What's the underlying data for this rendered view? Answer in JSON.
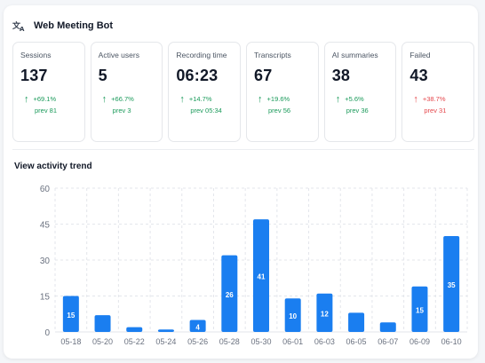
{
  "app": {
    "title": "Web Meeting Bot",
    "logo_icon": "translate-icon"
  },
  "colors": {
    "positive": "#1a9a5a",
    "negative": "#e5484d",
    "bar": "#1a7ef0",
    "grid": "#e3e6eb"
  },
  "stats": [
    {
      "label": "Sessions",
      "value": "137",
      "change": "+69.1%",
      "prev": "prev 81",
      "trend": "up"
    },
    {
      "label": "Active users",
      "value": "5",
      "change": "+66.7%",
      "prev": "prev 3",
      "trend": "up"
    },
    {
      "label": "Recording time",
      "value": "06:23",
      "change": "+14.7%",
      "prev": "prev 05:34",
      "trend": "up"
    },
    {
      "label": "Transcripts",
      "value": "67",
      "change": "+19.6%",
      "prev": "prev 56",
      "trend": "up"
    },
    {
      "label": "AI summaries",
      "value": "38",
      "change": "+5.6%",
      "prev": "prev 36",
      "trend": "up"
    },
    {
      "label": "Failed",
      "value": "43",
      "change": "+38.7%",
      "prev": "prev 31",
      "trend": "down"
    }
  ],
  "trend": {
    "title": "View activity trend"
  },
  "chart_data": {
    "type": "bar",
    "title": "View activity trend",
    "categories": [
      "05-18",
      "05-20",
      "05-22",
      "05-24",
      "05-26",
      "05-28",
      "05-30",
      "06-01",
      "06-03",
      "06-05",
      "06-07",
      "06-09",
      "06-10"
    ],
    "values": [
      15,
      7,
      2,
      1,
      5,
      32,
      47,
      14,
      16,
      8,
      4,
      19,
      40
    ],
    "data_labels": [
      "15",
      "",
      "",
      "",
      "4",
      "26",
      "41",
      "10",
      "12",
      "",
      "",
      "15",
      "35"
    ],
    "ylim": [
      0,
      60
    ],
    "yticks": [
      "0",
      "15",
      "30",
      "45",
      "60"
    ],
    "grid": true,
    "xlabel": "",
    "ylabel": ""
  }
}
